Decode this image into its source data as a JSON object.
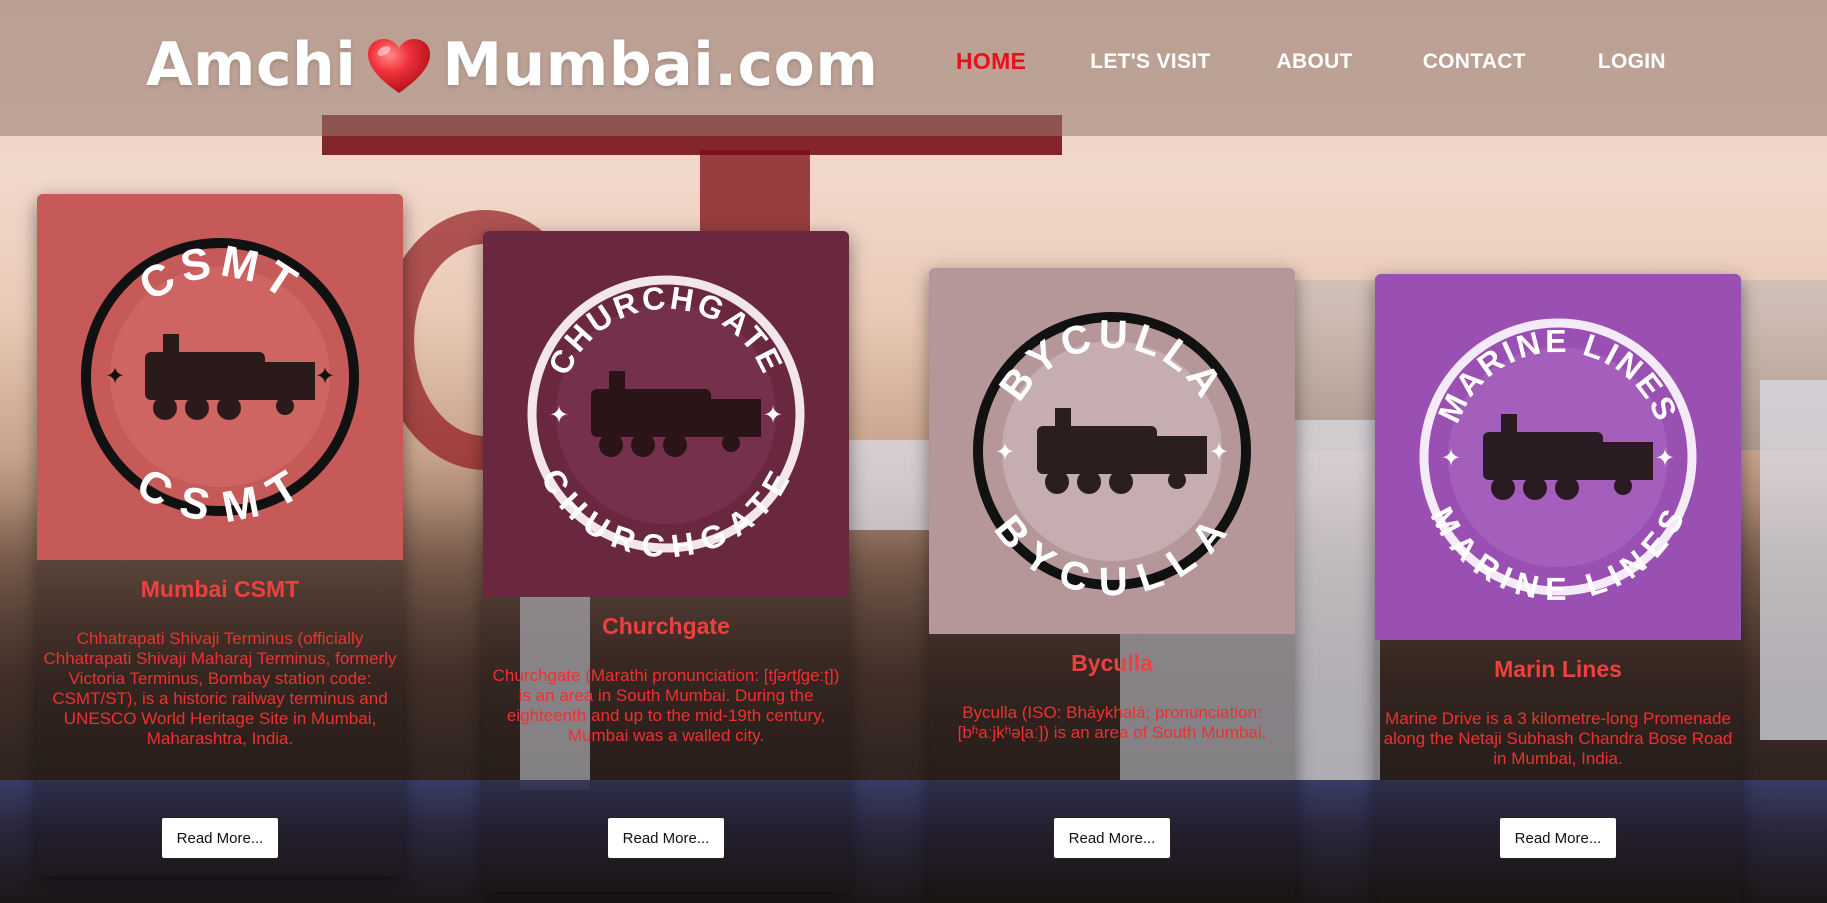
{
  "header": {
    "logo_left": "Amchi",
    "logo_right": "Mumbai.com",
    "nav": [
      {
        "label": "HOME",
        "active": true
      },
      {
        "label": "LET'S VISIT",
        "active": false
      },
      {
        "label": "ABOUT",
        "active": false
      },
      {
        "label": "CONTACT",
        "active": false
      },
      {
        "label": "LOGIN",
        "active": false
      }
    ]
  },
  "cards": [
    {
      "badge_text": "CSMT",
      "bg_color": "#c65a58",
      "ring_color": "#111111",
      "title": "Mumbai CSMT",
      "text": "Chhatrapati Shivaji Terminus (officially Chhatrapati Shivaji Maharaj Terminus, formerly Victoria Terminus, Bombay station code: CSMT/ST), is a historic railway terminus and UNESCO World Heritage Site in Mumbai, Maharashtra, India.",
      "button": "Read More..."
    },
    {
      "badge_text": "CHURCHGATE",
      "bg_color": "#6a2840",
      "ring_color": "#ffffff",
      "title": "Churchgate",
      "text": "Churchgate (Marathi pronunciation: [tʃəɾtʃɡeːʈ]) is an area in South Mumbai. During the eighteenth and up to the mid-19th century, Mumbai was a walled city.",
      "button": "Read More..."
    },
    {
      "badge_text": "BYCULLA",
      "bg_color": "#b5979a",
      "ring_color": "#111111",
      "title": "Byculla",
      "text": "Byculla (ISO: Bhāykhaḷā; pronunciation: [bʱaːjkʰəɭaː]) is an area of South Mumbai.",
      "button": "Read More..."
    },
    {
      "badge_text": "MARINE LINES",
      "bg_color": "#9a4fb2",
      "ring_color": "#ffffff",
      "title": "Marin Lines",
      "text": "Marine Drive is a 3 kilometre-long Promenade along the Netaji Subhash Chandra Bose Road in Mumbai, India.",
      "button": "Read More..."
    }
  ]
}
